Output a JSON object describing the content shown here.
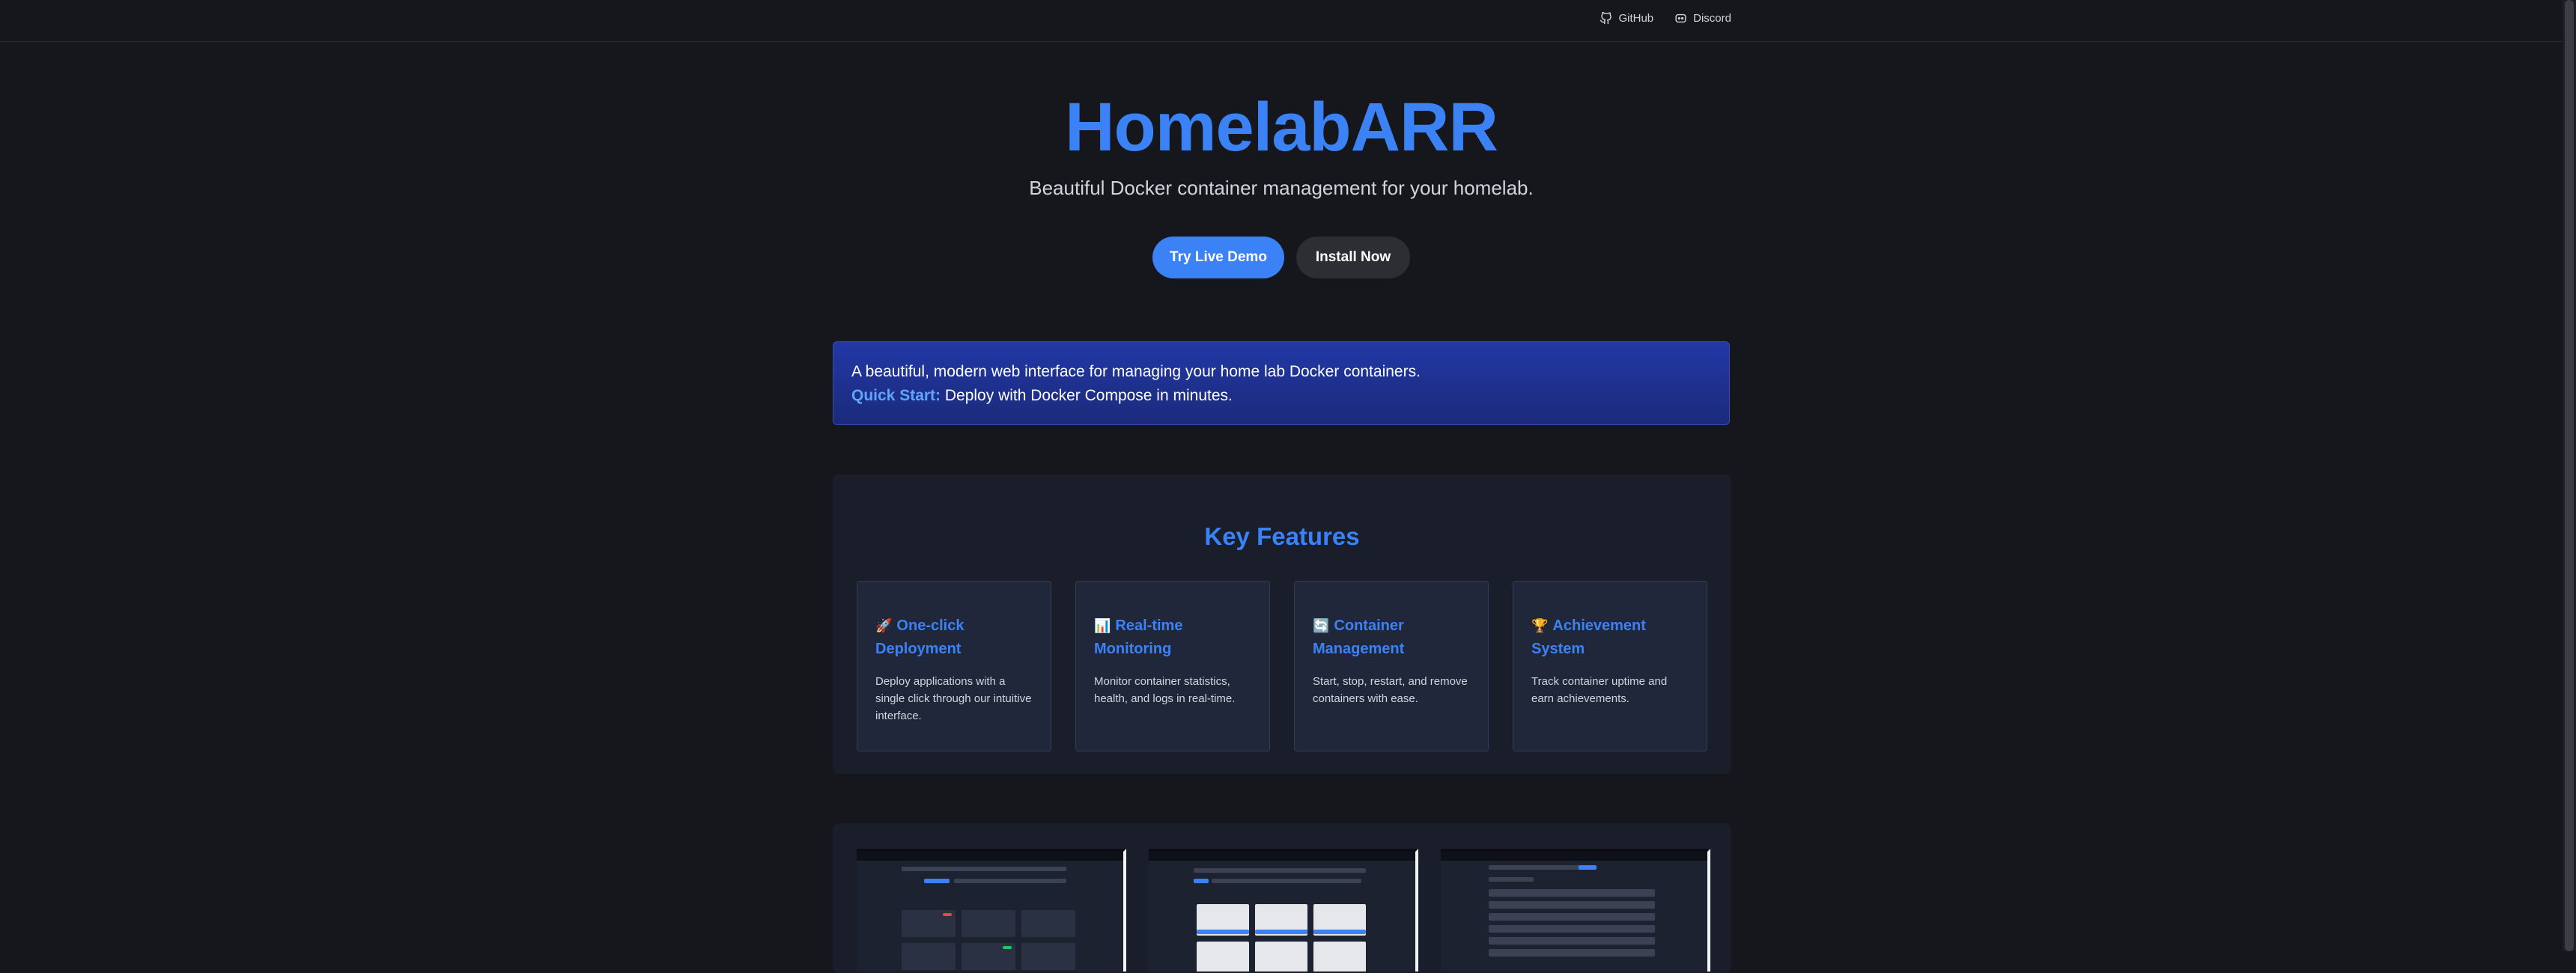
{
  "nav": {
    "links": [
      {
        "label": "GitHub",
        "icon": "github-icon"
      },
      {
        "label": "Discord",
        "icon": "discord-icon"
      }
    ]
  },
  "hero": {
    "title": "HomelabARR",
    "subtitle": "Beautiful Docker container management for your homelab.",
    "primary_button": "Try Live Demo",
    "secondary_button": "Install Now"
  },
  "banner": {
    "line1": "A beautiful, modern web interface for managing your home lab Docker containers.",
    "quick_start_label": "Quick Start:",
    "quick_start_text": " Deploy with Docker Compose in minutes."
  },
  "features": {
    "title": "Key Features",
    "cards": [
      {
        "emoji": "🚀",
        "title": "One-click Deployment",
        "desc": "Deploy applications with a single click through our intuitive interface."
      },
      {
        "emoji": "📊",
        "title": "Real-time Monitoring",
        "desc": "Monitor container statistics, health, and logs in real-time."
      },
      {
        "emoji": "🔄",
        "title": "Container Management",
        "desc": "Start, stop, restart, and remove containers with ease."
      },
      {
        "emoji": "🏆",
        "title": "Achievement System",
        "desc": "Track container uptime and earn achievements."
      }
    ]
  },
  "colors": {
    "accent": "#3b82f6",
    "background": "#15171c",
    "banner_start": "#2238a6",
    "banner_end": "#1b2a7a"
  }
}
